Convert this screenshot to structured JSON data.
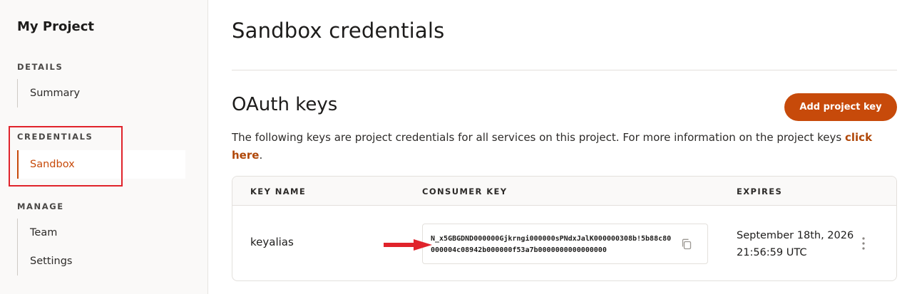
{
  "sidebar": {
    "project_title": "My Project",
    "sections": [
      {
        "label": "DETAILS",
        "items": [
          {
            "label": "Summary"
          }
        ]
      },
      {
        "label": "CREDENTIALS",
        "items": [
          {
            "label": "Sandbox",
            "active": true
          }
        ]
      },
      {
        "label": "MANAGE",
        "items": [
          {
            "label": "Team"
          },
          {
            "label": "Settings"
          }
        ]
      }
    ]
  },
  "main": {
    "page_title": "Sandbox credentials",
    "section_title": "OAuth keys",
    "add_button_label": "Add project key",
    "description": "The following keys are project credentials for all services on this project. For more information on the project keys ",
    "description_link": "click here",
    "description_end": ".",
    "table": {
      "headers": {
        "key_name": "KEY NAME",
        "consumer_key": "CONSUMER KEY",
        "expires": "EXPIRES"
      },
      "rows": [
        {
          "key_name": "keyalias",
          "consumer_key": "N_x5GBGDND000000Gjkrngi000000sPNdxJalK000000308b!5b88c80000004c08942b000000f53a7b0000000000000000",
          "expires_date": "September 18th, 2026",
          "expires_time": "21:56:59 UTC"
        }
      ]
    }
  },
  "icons": {
    "copy": "copy-icon",
    "more": "kebab-menu-icon",
    "annotation": "red-arrow-icon"
  },
  "colors": {
    "accent": "#c74a0a",
    "annotation": "#e0232b",
    "sidebar_bg": "#faf9f8"
  }
}
